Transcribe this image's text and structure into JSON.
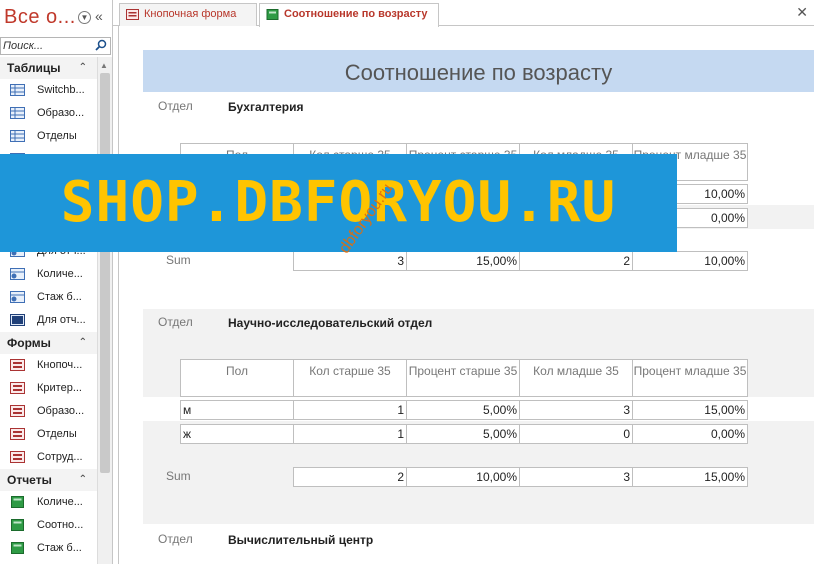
{
  "nav": {
    "title": "Все о...",
    "search_placeholder": "Поиск...",
    "groups": [
      {
        "name": "Таблицы",
        "items": [
          "Switchb...",
          "Образо...",
          "Отделы",
          ""
        ]
      },
      {
        "name": "",
        "items": [
          "Для отч...",
          "Количе...",
          "Стаж б...",
          "Для отч..."
        ]
      },
      {
        "name": "Формы",
        "items": [
          "Кнопоч...",
          "Критер...",
          "Образо...",
          "Отделы",
          "Сотруд..."
        ]
      },
      {
        "name": "Отчеты",
        "items": [
          "Количе...",
          "Соотно...",
          "Стаж б..."
        ]
      }
    ]
  },
  "tabs": [
    {
      "label": "Кнопочная форма",
      "active": false
    },
    {
      "label": "Соотношение по возрасту",
      "active": true
    }
  ],
  "report": {
    "title": "Соотношение по возрасту",
    "dept_label": "Отдел",
    "sum_label": "Sum",
    "headers": [
      "Пол",
      "Кол старше 35",
      "Процент старше 35",
      "Кол младше 35",
      "Процент младше 35"
    ],
    "sections": [
      {
        "dept": "Бухгалтерия",
        "rows": [
          [
            "",
            "",
            "",
            "",
            "10,00%"
          ],
          [
            "",
            "",
            "",
            "",
            "0,00%"
          ]
        ],
        "sum": [
          "3",
          "15,00%",
          "2",
          "10,00%"
        ]
      },
      {
        "dept": "Научно-исследовательский отдел",
        "rows": [
          [
            "м",
            "1",
            "5,00%",
            "3",
            "15,00%"
          ],
          [
            "ж",
            "1",
            "5,00%",
            "0",
            "0,00%"
          ]
        ],
        "sum": [
          "2",
          "10,00%",
          "3",
          "15,00%"
        ]
      },
      {
        "dept": "Вычислительный центр",
        "rows": [],
        "sum": []
      }
    ]
  },
  "watermark": {
    "banner": "SHOP.DBFORYOU.RU",
    "diagonal": "dbforyou.ru"
  },
  "colors": {
    "title_band": "#c5d9f1",
    "banner_bg": "#1e96d9",
    "banner_text": "#ffc400",
    "accent_red": "#c0392b",
    "watermark_orange": "#e36c0a"
  }
}
